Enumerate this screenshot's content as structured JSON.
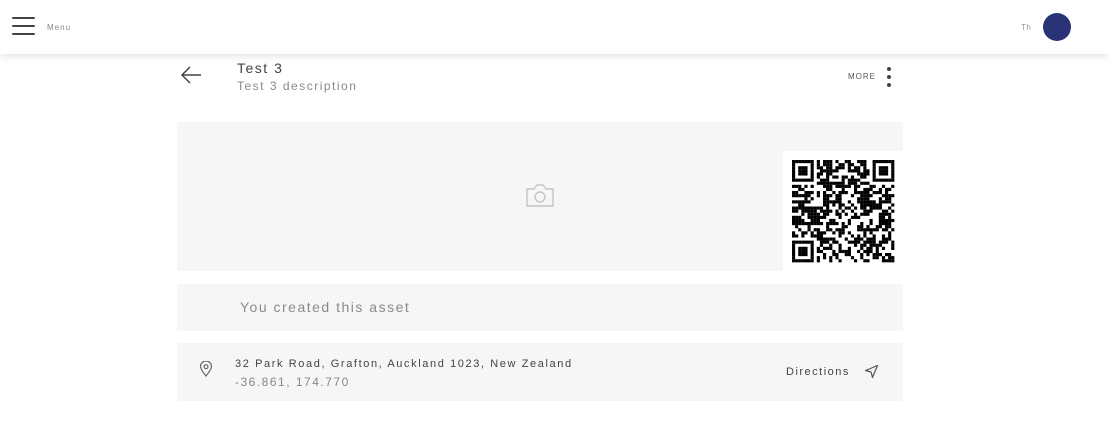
{
  "header": {
    "menu_label": "Menu",
    "user_initials": "Th",
    "avatar_color": "#2a3377"
  },
  "asset": {
    "title": "Test 3",
    "description": "Test 3 description",
    "more_label": "MORE",
    "created_note": "You created this asset"
  },
  "location": {
    "address": "32 Park Road, Grafton, Auckland 1023, New Zealand",
    "coordinates": "-36.861, 174.770",
    "directions_label": "Directions"
  },
  "icons": {
    "menu": "hamburger-icon",
    "back": "arrow-left-icon",
    "more": "kebab-vertical-icon",
    "photo": "camera-icon",
    "location": "map-pin-icon",
    "directions": "navigation-arrow-icon"
  }
}
